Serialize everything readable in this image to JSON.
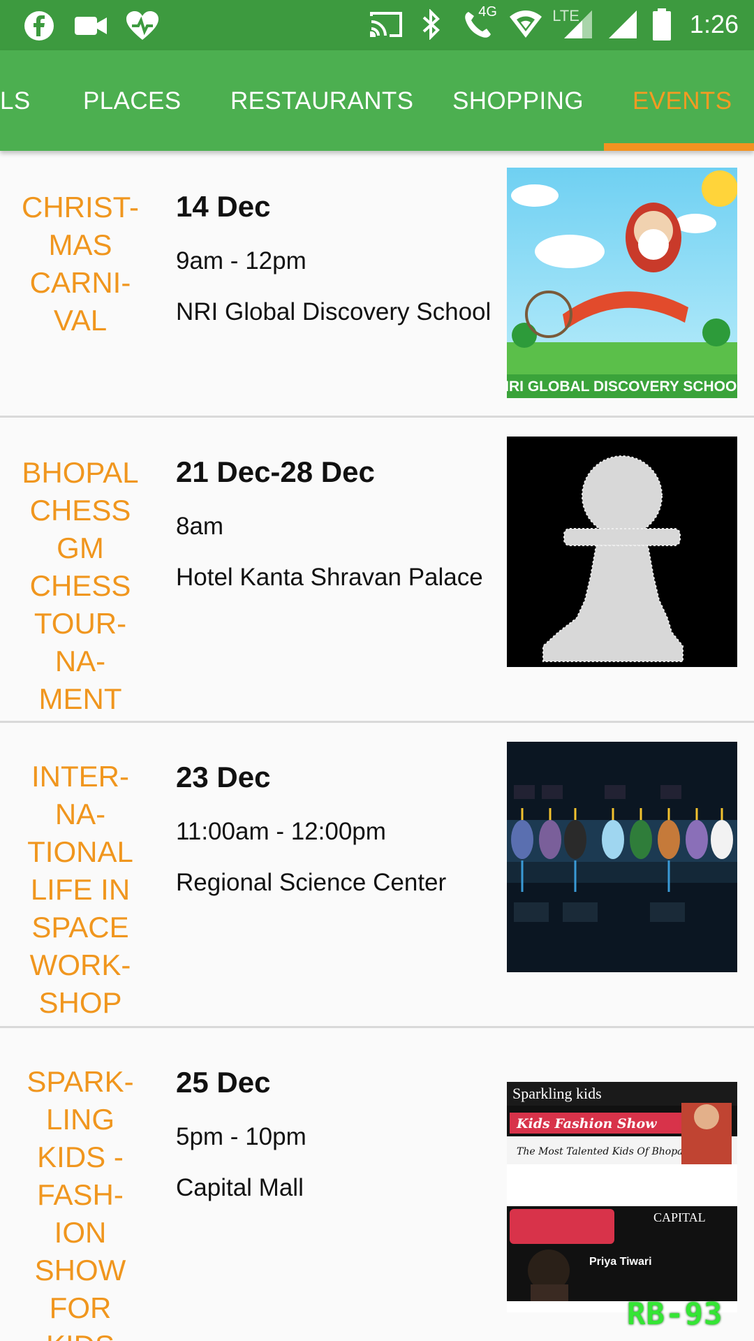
{
  "status_bar": {
    "time": "1:26",
    "network_label": "4G",
    "lte_label": "LTE",
    "icons": [
      "facebook-icon",
      "video-camera-icon",
      "heart-health-icon",
      "cast-icon",
      "bluetooth-icon",
      "wifi-call-icon",
      "wifi-icon",
      "signal-icon",
      "signal-icon-2",
      "battery-icon"
    ],
    "color": "#3d9a3f"
  },
  "tabs": [
    {
      "label": "LS"
    },
    {
      "label": "PLACES"
    },
    {
      "label": "RESTAURANTS"
    },
    {
      "label": "SHOPPING"
    },
    {
      "label": "EVENTS"
    }
  ],
  "active_tab": "EVENTS",
  "colors": {
    "tab_bar": "#4caf50",
    "accent": "#f39321",
    "event_name": "#f0961e"
  },
  "events": [
    {
      "name": "CHRIST-\nMAS\nCARNI-\nVAL",
      "date": "14 Dec",
      "time": "9am - 12pm",
      "venue": "NRI Global Discovery School",
      "poster_text": "NRI GLOBAL DISCOVERY SCHOOL"
    },
    {
      "name": "BHOPAL\nCHESS\nGM\nCHESS\nTOUR-\nNA-\nMENT",
      "date": "21 Dec-28 Dec",
      "time": "8am",
      "venue": "Hotel Kanta Shravan Palace"
    },
    {
      "name": "INTER-\nNA-\nTIONAL\nLIFE IN\nSPACE\nWORK-\nSHOP",
      "date": "23 Dec",
      "time": "11:00am - 12:00pm",
      "venue": "Regional Science Center"
    },
    {
      "name": "SPARK-\nLING\nKIDS -\nFASH-\nION\nSHOW\nFOR\nKIDS",
      "date": "25 Dec",
      "time": "5pm - 10pm",
      "venue": "Capital Mall",
      "poster_brand": "Sparkling kids",
      "poster_title": "Kids Fashion Show",
      "poster_tagline": "The Most Talented Kids Of Bhopal",
      "poster_venue": "CAPITAL",
      "poster_person": "Priya Tiwari"
    }
  ],
  "watermark": "RB-93"
}
